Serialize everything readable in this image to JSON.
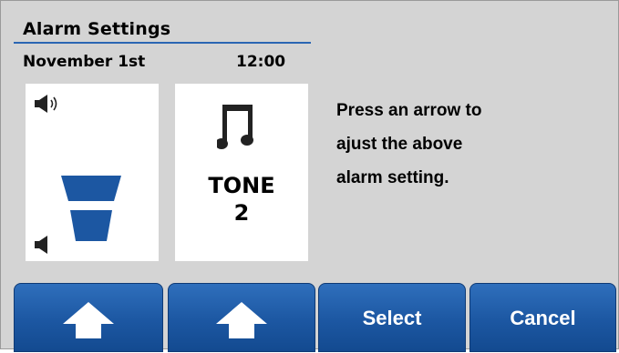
{
  "header": {
    "title": "Alarm Settings",
    "date": "November 1st",
    "time": "12:00"
  },
  "volume_card": {
    "icons": [
      "speaker-loud-icon",
      "speaker-quiet-icon"
    ],
    "level_bars": 2
  },
  "tone_card": {
    "icon": "music-note-icon",
    "label_line1": "TONE",
    "label_line2": "2"
  },
  "instructions": [
    "Press an arrow to",
    "ajust the above",
    "alarm setting."
  ],
  "buttons": {
    "volume_up_icon": "arrow-up-icon",
    "tone_up_icon": "arrow-up-icon",
    "select_label": "Select",
    "cancel_label": "Cancel"
  },
  "colors": {
    "accent": "#1c57a2",
    "background": "#d4d4d4",
    "card": "#ffffff"
  }
}
